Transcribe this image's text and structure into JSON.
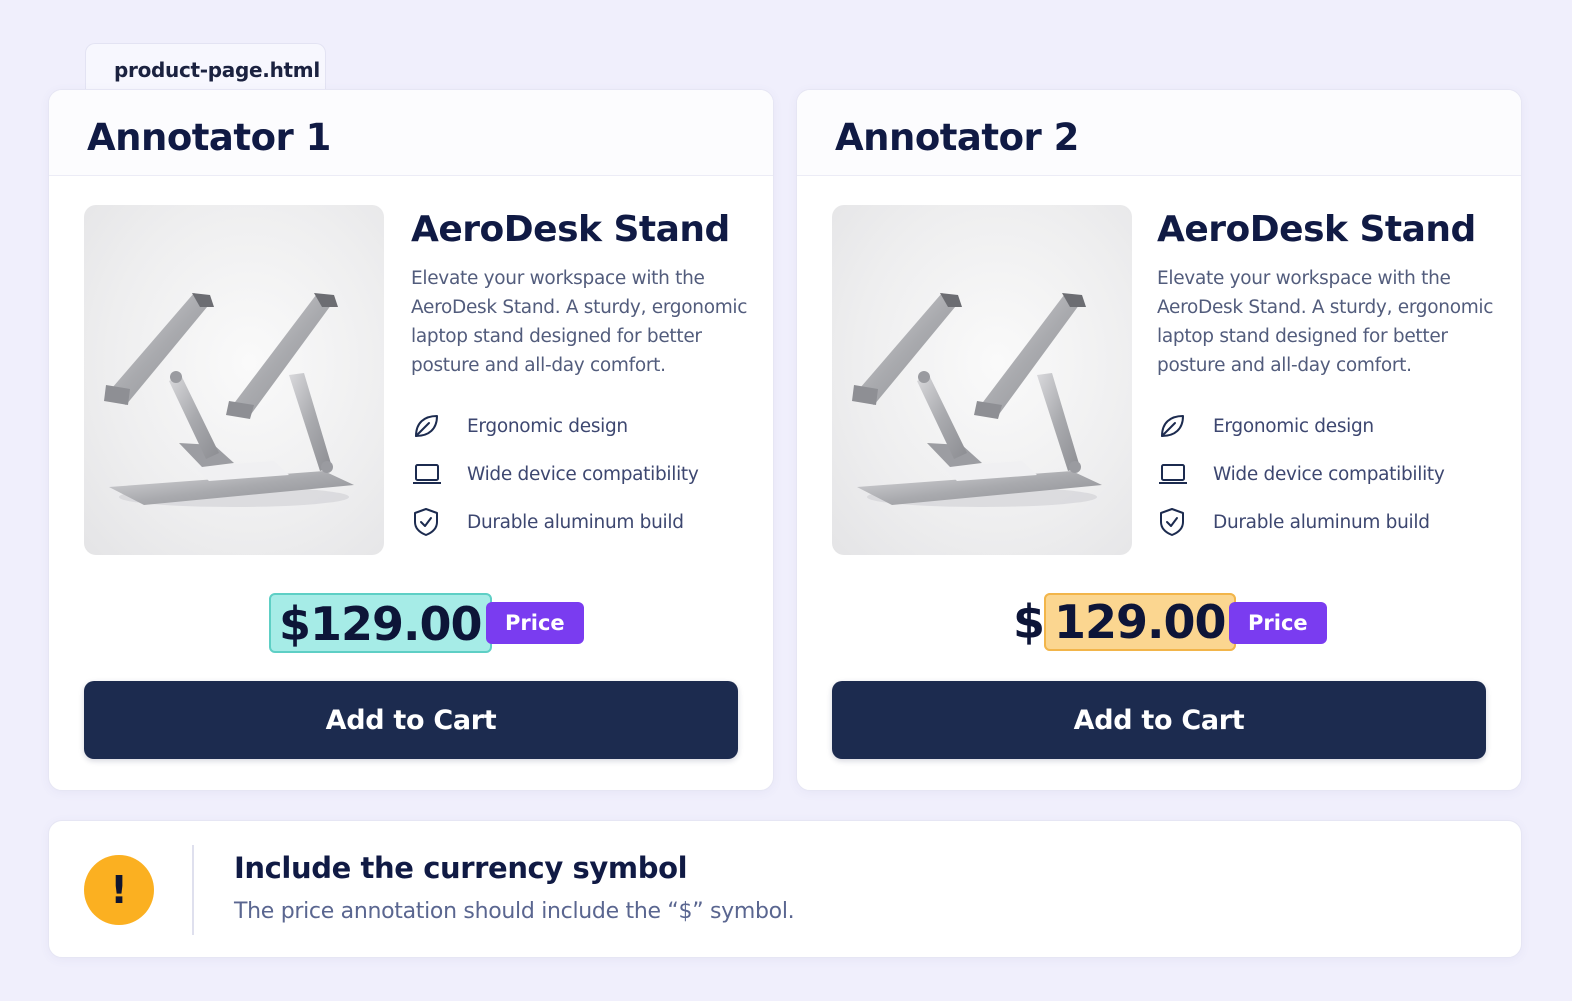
{
  "file_tab": "product-page.html",
  "panels": [
    {
      "heading": "Annotator 1",
      "product": {
        "name": "AeroDesk Stand",
        "description": "Elevate your workspace with the AeroDesk Stand. A sturdy, ergonomic laptop stand designed for better posture and all-day comfort.",
        "features": [
          {
            "icon": "leaf-icon",
            "label": "Ergonomic design"
          },
          {
            "icon": "laptop-icon",
            "label": "Wide device compatibility"
          },
          {
            "icon": "shield-check-icon",
            "label": "Durable aluminum build"
          }
        ]
      },
      "price": {
        "symbol": "$",
        "amount": "129.00",
        "highlight_includes_symbol": true,
        "highlight_color": "#a6ece7"
      },
      "tag": "Price",
      "button": "Add to Cart"
    },
    {
      "heading": "Annotator 2",
      "product": {
        "name": "AeroDesk Stand",
        "description": "Elevate your workspace with the AeroDesk Stand. A sturdy, ergonomic laptop stand designed for better posture and all-day comfort.",
        "features": [
          {
            "icon": "leaf-icon",
            "label": "Ergonomic design"
          },
          {
            "icon": "laptop-icon",
            "label": "Wide device compatibility"
          },
          {
            "icon": "shield-check-icon",
            "label": "Durable aluminum build"
          }
        ]
      },
      "price": {
        "symbol": "$",
        "amount": "129.00",
        "highlight_includes_symbol": false,
        "highlight_color": "#fbd690"
      },
      "tag": "Price",
      "button": "Add to Cart"
    }
  ],
  "note": {
    "icon": "warning-icon",
    "icon_glyph": "!",
    "title": "Include the currency symbol",
    "body": "The price annotation should include the “$” symbol."
  },
  "colors": {
    "tag": "#7a3cf0",
    "button": "#1c2b4f",
    "warning": "#fbb021"
  }
}
